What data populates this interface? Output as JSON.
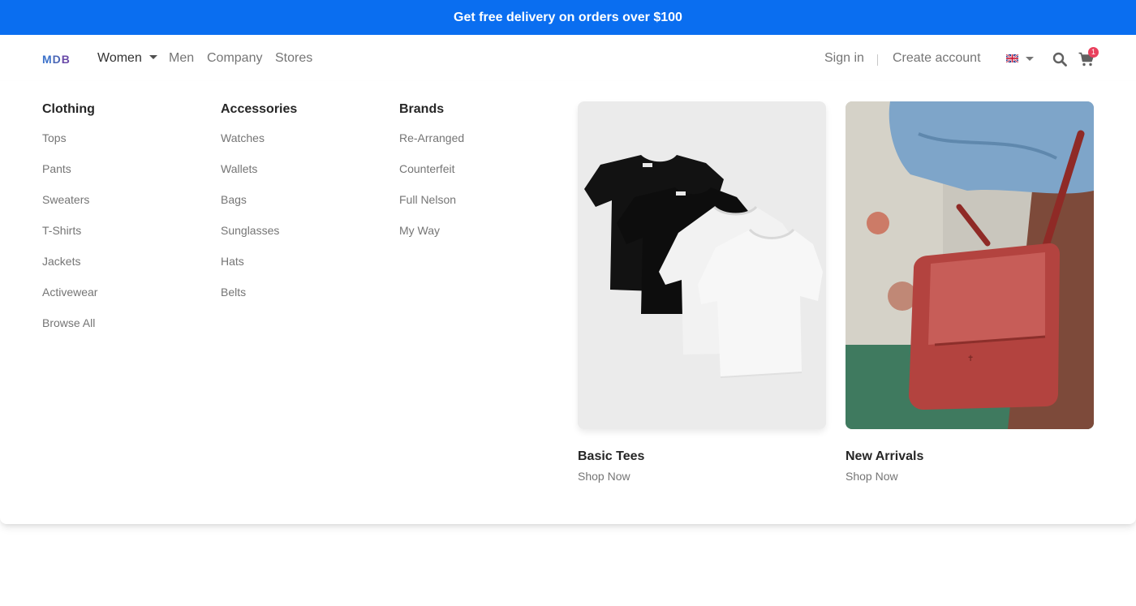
{
  "promo": {
    "text": "Get free delivery on orders over $100"
  },
  "brand": {
    "m": "M",
    "d": "D",
    "b": "B"
  },
  "nav": {
    "women": "Women",
    "men": "Men",
    "company": "Company",
    "stores": "Stores",
    "sign_in": "Sign in",
    "create_account": "Create account",
    "cart_count": "1",
    "language_icon": "uk-flag-icon",
    "search_icon": "search-icon",
    "cart_icon": "cart-icon"
  },
  "colors": {
    "accent": "#0a6ef0",
    "badge": "#e9405d"
  },
  "menu": {
    "clothing": {
      "heading": "Clothing",
      "items": [
        "Tops",
        "Pants",
        "Sweaters",
        "T-Shirts",
        "Jackets",
        "Activewear",
        "Browse All"
      ]
    },
    "accessories": {
      "heading": "Accessories",
      "items": [
        "Watches",
        "Wallets",
        "Bags",
        "Sunglasses",
        "Hats",
        "Belts"
      ]
    },
    "brands": {
      "heading": "Brands",
      "items": [
        "Re-Arranged",
        "Counterfeit",
        "Full Nelson",
        "My Way"
      ]
    }
  },
  "featured": [
    {
      "title": "Basic Tees",
      "link": "Shop Now"
    },
    {
      "title": "New Arrivals",
      "link": "Shop Now"
    }
  ]
}
